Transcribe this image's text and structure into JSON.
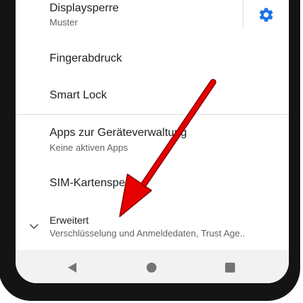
{
  "settings_list": {
    "items": [
      {
        "title": "Displaysperre",
        "subtitle": "Muster"
      },
      {
        "title": "Fingerabdruck"
      },
      {
        "title": "Smart Lock"
      },
      {
        "title": "Apps zur Geräteverwaltung",
        "subtitle": "Keine aktiven Apps"
      },
      {
        "title": "SIM-Kartensperre"
      },
      {
        "title": "Erweitert",
        "subtitle": "Verschlüsselung und Anmeldedaten, Trust Age.."
      }
    ]
  },
  "icons": {
    "settings": "gear-icon",
    "expand": "chevron-down-icon",
    "back": "back-triangle-icon",
    "home": "home-circle-icon",
    "recents": "recents-square-icon",
    "annotation": "red-arrow-icon"
  },
  "colors": {
    "accent": "#1a73e8",
    "arrow": "#e60000",
    "frame": "#141414",
    "nav_bar": "#f2f2f2"
  }
}
